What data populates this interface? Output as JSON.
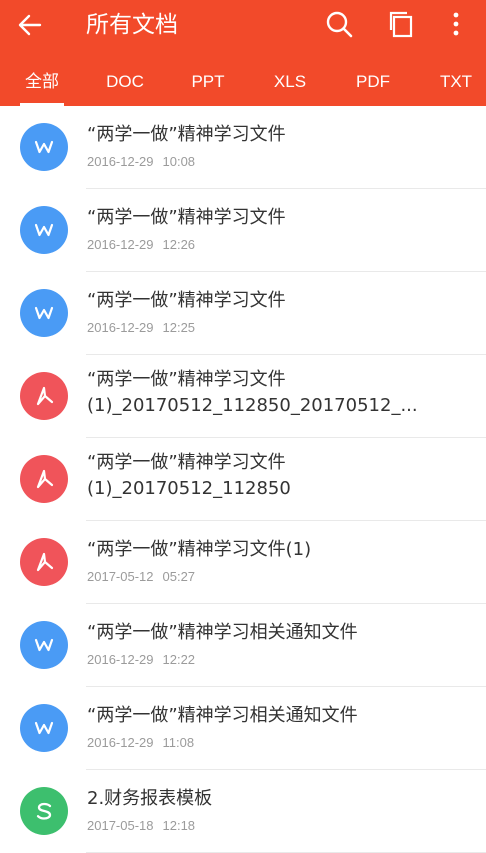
{
  "header": {
    "title": "所有文档"
  },
  "tabs": [
    {
      "label": "全部"
    },
    {
      "label": "DOC"
    },
    {
      "label": "PPT"
    },
    {
      "label": "XLS"
    },
    {
      "label": "PDF"
    },
    {
      "label": "TXT"
    }
  ],
  "colors": {
    "accent": "#f24a2a",
    "word": "#4a9bf5",
    "pdf": "#f0545a",
    "sheet": "#3dbf6e"
  },
  "files": [
    {
      "name": "“两学一做”精神学习文件",
      "date": "2016-12-29",
      "time": "10:08",
      "icon": "word-icon"
    },
    {
      "name": "“两学一做”精神学习文件",
      "date": "2016-12-29",
      "time": "12:26",
      "icon": "word-icon"
    },
    {
      "name": "“两学一做”精神学习文件",
      "date": "2016-12-29",
      "time": "12:25",
      "icon": "word-icon"
    },
    {
      "name": "“两学一做”精神学习文件\n(1)_20170512_112850_20170512_...",
      "date": "",
      "time": "",
      "icon": "pdf-icon"
    },
    {
      "name": "“两学一做”精神学习文件\n(1)_20170512_112850",
      "date": "",
      "time": "",
      "icon": "pdf-icon"
    },
    {
      "name": "“两学一做”精神学习文件(1)",
      "date": "2017-05-12",
      "time": "05:27",
      "icon": "pdf-icon"
    },
    {
      "name": "“两学一做”精神学习相关通知文件",
      "date": "2016-12-29",
      "time": "12:22",
      "icon": "word-icon"
    },
    {
      "name": "“两学一做”精神学习相关通知文件",
      "date": "2016-12-29",
      "time": "11:08",
      "icon": "word-icon"
    },
    {
      "name": "2.财务报表模板",
      "date": "2017-05-18",
      "time": "12:18",
      "icon": "sheet-icon"
    }
  ]
}
